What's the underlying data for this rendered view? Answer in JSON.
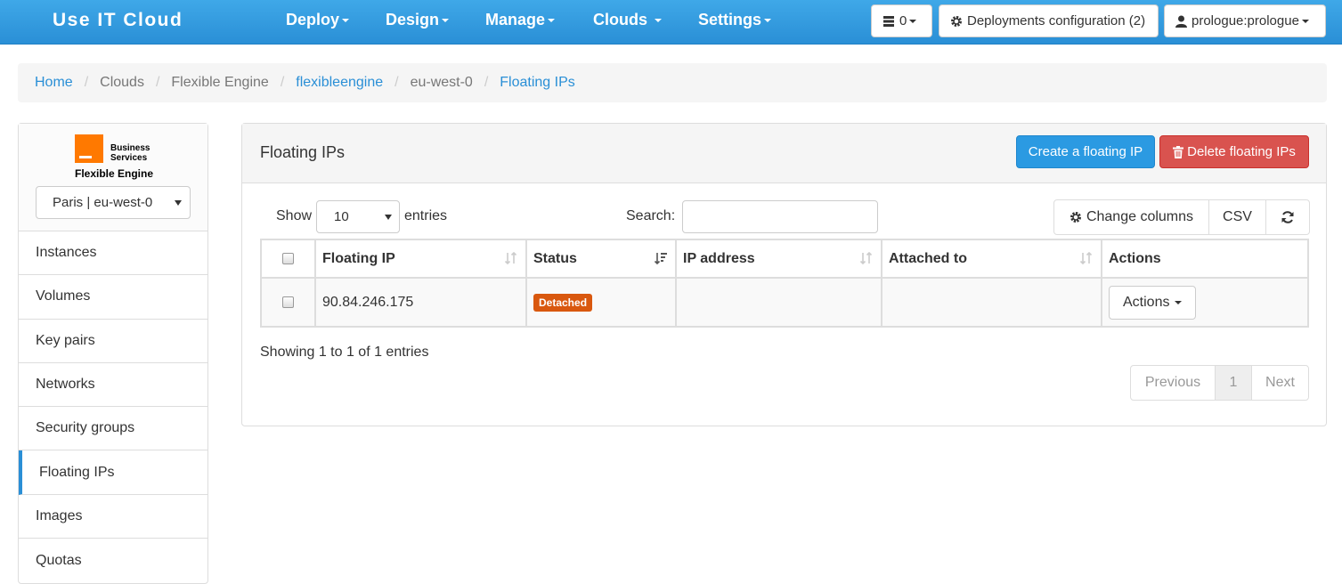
{
  "navbar": {
    "brand": "Use IT Cloud",
    "menus": [
      {
        "label": "Deploy"
      },
      {
        "label": "Design"
      },
      {
        "label": "Manage"
      },
      {
        "label": "Clouds"
      },
      {
        "label": "Settings"
      }
    ],
    "counter_value": "0",
    "deployments_config": "Deployments configuration (2)",
    "user": "prologue:prologue"
  },
  "breadcrumb": {
    "items": [
      "Home",
      "Clouds",
      "Flexible Engine",
      "flexibleengine",
      "eu-west-0",
      "Floating IPs"
    ]
  },
  "sidebar": {
    "logo_line1": "Business",
    "logo_line2": "Services",
    "logo_sub": "Flexible Engine",
    "region": "Paris | eu-west-0",
    "items": [
      {
        "label": "Instances"
      },
      {
        "label": "Volumes"
      },
      {
        "label": "Key pairs"
      },
      {
        "label": "Networks"
      },
      {
        "label": "Security groups"
      },
      {
        "label": "Floating IPs"
      },
      {
        "label": "Images"
      },
      {
        "label": "Quotas"
      }
    ]
  },
  "panel": {
    "title": "Floating IPs",
    "create_label": "Create a floating IP",
    "delete_label": "Delete floating IPs",
    "show_label": "Show",
    "page_length": "10",
    "entries_label": "entries",
    "search_label": "Search:",
    "search_value": "",
    "change_columns": "Change columns",
    "csv": "CSV"
  },
  "table": {
    "headers": [
      "Floating IP",
      "Status",
      "IP address",
      "Attached to",
      "Actions"
    ],
    "rows": [
      {
        "floating_ip": "90.84.246.175",
        "status": "Detached",
        "ip_address": "",
        "attached_to": "",
        "actions": "Actions"
      }
    ]
  },
  "footer": {
    "showing": "Showing 1 to 1 of 1 entries",
    "previous": "Previous",
    "page": "1",
    "next": "Next"
  },
  "colors": {
    "navbar": "#2a8fd6",
    "primary": "#2b9ae2",
    "danger": "#d9534f",
    "badge_detached": "#d9580f",
    "logo_orange": "#ff7900"
  }
}
